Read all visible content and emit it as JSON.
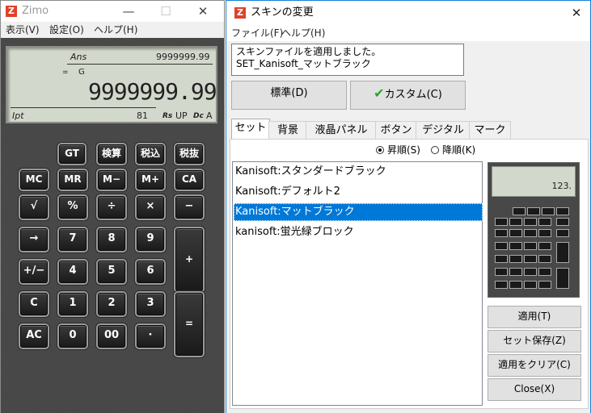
{
  "calc": {
    "title": "Zimo",
    "logo": "Z",
    "window_buttons": {
      "minimize": "—",
      "maximize": "☐",
      "close": "✕"
    },
    "menu": [
      "表示(V)",
      "設定(O)",
      "ヘルプ(H)"
    ],
    "lcd": {
      "ans_label": "Ans",
      "ans_value": "9999999.99",
      "eq": "=",
      "g": "G",
      "main_value": "9999999.99",
      "ipt": "Ipt",
      "count": "81",
      "rs": "Rs",
      "up": "UP",
      "dc": "Dc",
      "a": "A"
    },
    "keys": {
      "gt": "GT",
      "kensan": "検算",
      "zeikomi": "税込",
      "zeinuki": "税抜",
      "mc": "MC",
      "mr": "MR",
      "mminus": "M−",
      "mplus": "M+",
      "ca": "CA",
      "sqrt": "√",
      "percent": "%",
      "divide": "÷",
      "multiply": "×",
      "minus": "−",
      "arrow": "→",
      "k7": "7",
      "k8": "8",
      "k9": "9",
      "plus": "+",
      "plusminus": "+/−",
      "k4": "4",
      "k5": "5",
      "k6": "6",
      "c": "C",
      "k1": "1",
      "k2": "2",
      "k3": "3",
      "equals": "=",
      "ac": "AC",
      "k0": "0",
      "k00": "00",
      "dot": "·"
    }
  },
  "dialog": {
    "title": "スキンの変更",
    "logo": "Z",
    "close": "✕",
    "menu": [
      "ファイル(F)",
      "ヘルプ(H)"
    ],
    "status_line1": "スキンファイルを適用しました。",
    "status_line2": "SET_Kanisoft_マットブラック",
    "btn_standard": "標準(D)",
    "btn_custom": "カスタム(C)",
    "check_mark": "✔",
    "tabs": [
      "セット",
      "背景",
      "液晶パネル",
      "ボタン",
      "デジタル",
      "マーク"
    ],
    "sort_asc": "昇順(S)",
    "sort_desc": "降順(K)",
    "list": [
      "Kanisoft:スタンダードブラック",
      "Kanisoft:デフォルト2",
      "Kanisoft:マットブラック",
      "kanisoft:蛍光緑ブロック"
    ],
    "selected_index": 2,
    "preview_value": "123.",
    "buttons": {
      "apply": "適用(T)",
      "save_set": "セット保存(Z)",
      "clear_apply": "適用をクリア(C)",
      "close": "Close(X)"
    },
    "colors": {
      "selection": "#0078d7",
      "accent_border": "#1683d8",
      "check": "#2ea12e",
      "logo": "#e0402a"
    }
  }
}
